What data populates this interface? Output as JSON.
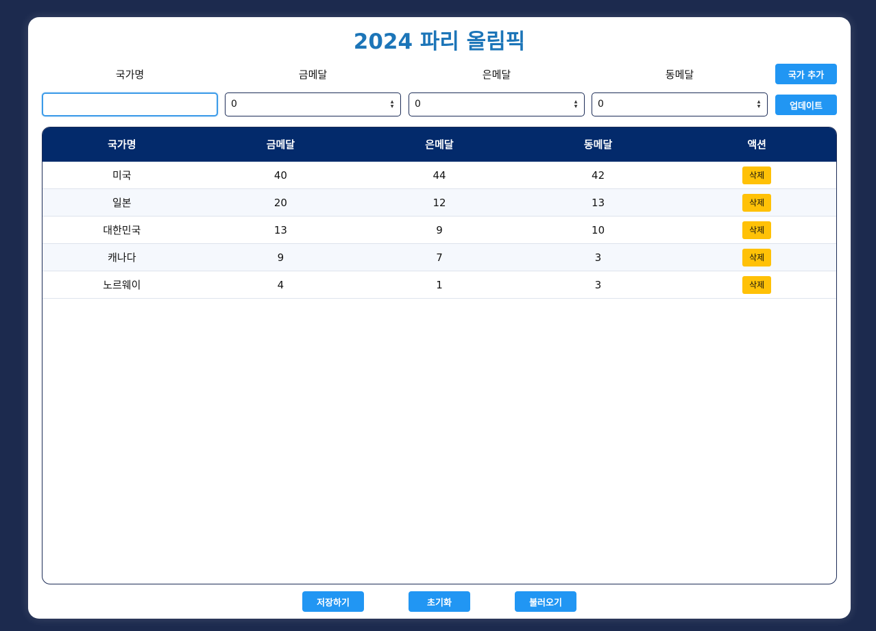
{
  "title": "2024 파리 올림픽",
  "form": {
    "labels": [
      "국가명",
      "금메달",
      "은메달",
      "동메달"
    ],
    "country_value": "",
    "gold_value": "0",
    "silver_value": "0",
    "bronze_value": "0",
    "add_button": "국가 추가",
    "update_button": "업데이트"
  },
  "table": {
    "headers": [
      "국가명",
      "금메달",
      "은메달",
      "동메달",
      "액션"
    ],
    "delete_label": "삭제",
    "rows": [
      {
        "country": "미국",
        "gold": "40",
        "silver": "44",
        "bronze": "42"
      },
      {
        "country": "일본",
        "gold": "20",
        "silver": "12",
        "bronze": "13"
      },
      {
        "country": "대한민국",
        "gold": "13",
        "silver": "9",
        "bronze": "10"
      },
      {
        "country": "캐나다",
        "gold": "9",
        "silver": "7",
        "bronze": "3"
      },
      {
        "country": "노르웨이",
        "gold": "4",
        "silver": "1",
        "bronze": "3"
      }
    ]
  },
  "footer": {
    "save_button": "저장하기",
    "reset_button": "초기화",
    "load_button": "불러오기"
  },
  "colors": {
    "background": "#1c2a4e",
    "title": "#1c75b8",
    "header": "#032a6b",
    "primary_button": "#2196f3",
    "delete_button": "#ffc107"
  }
}
